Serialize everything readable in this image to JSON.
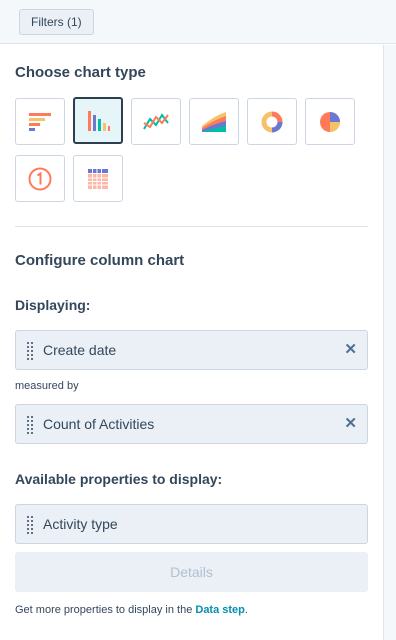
{
  "toolbar": {
    "filters_label": "Filters (1)"
  },
  "chart_type": {
    "heading": "Choose chart type",
    "options": [
      {
        "icon": "horizontal-bar-chart-icon",
        "selected": false
      },
      {
        "icon": "column-chart-icon",
        "selected": true
      },
      {
        "icon": "line-chart-icon",
        "selected": false
      },
      {
        "icon": "area-chart-icon",
        "selected": false
      },
      {
        "icon": "donut-chart-icon",
        "selected": false
      },
      {
        "icon": "pie-chart-icon",
        "selected": false
      },
      {
        "icon": "summary-number-icon",
        "selected": false
      },
      {
        "icon": "pivot-table-icon",
        "selected": false
      }
    ]
  },
  "configure": {
    "heading": "Configure column chart",
    "displaying_label": "Displaying:",
    "displaying_value": "Create date",
    "measured_by_label": "measured by",
    "measured_value": "Count of Activities"
  },
  "available": {
    "heading": "Available properties to display:",
    "property": "Activity type",
    "details_label": "Details"
  },
  "footer": {
    "text_before": "Get more properties to display in the ",
    "link_text": "Data step",
    "text_after": "."
  },
  "colors": {
    "orange": "#ff7a59",
    "teal": "#00bda5",
    "purple": "#6a78d1",
    "yellow": "#f5c26b",
    "link": "#0091ae"
  }
}
